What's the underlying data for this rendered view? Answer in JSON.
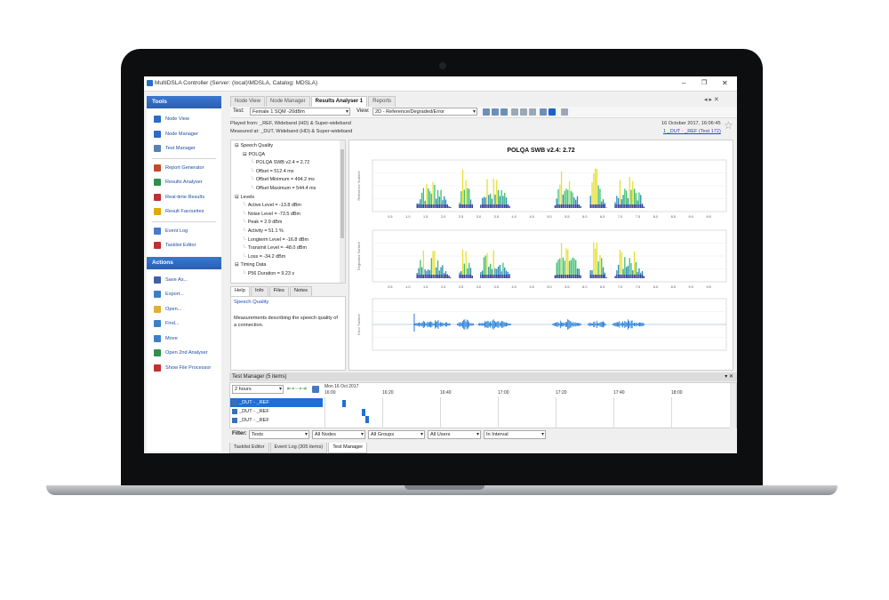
{
  "window": {
    "title": "MultiDSLA Controller (Server: (local)\\MDSLA, Catalog: MDSLA)"
  },
  "tools": {
    "title": "Tools",
    "items": [
      {
        "label": "Node View",
        "icon": "node-view-icon",
        "color": "#2e6bc6"
      },
      {
        "label": "Node Manager",
        "icon": "node-manager-icon",
        "color": "#2e6bc6"
      },
      {
        "label": "Test Manager",
        "icon": "test-manager-icon",
        "color": "#5a7fb8"
      },
      {
        "label": "Report Generator",
        "icon": "report-generator-icon",
        "color": "#c04a2a"
      },
      {
        "label": "Results Analyser",
        "icon": "results-analyser-icon",
        "color": "#2e8f4e"
      },
      {
        "label": "Real-time Results",
        "icon": "real-time-results-icon",
        "color": "#c03030"
      },
      {
        "label": "Result Favourites",
        "icon": "star-icon",
        "color": "#e0a800"
      },
      {
        "label": "Event Log",
        "icon": "event-log-icon",
        "color": "#4a7ac8"
      },
      {
        "label": "Tasklist Editor",
        "icon": "tasklist-editor-icon",
        "color": "#c03030"
      }
    ]
  },
  "actions": {
    "title": "Actions",
    "items": [
      {
        "label": "Save As...",
        "icon": "save-icon",
        "color": "#3d5fa6"
      },
      {
        "label": "Export...",
        "icon": "export-icon",
        "color": "#3d7fc6"
      },
      {
        "label": "Open...",
        "icon": "open-folder-icon",
        "color": "#e0b030"
      },
      {
        "label": "Find...",
        "icon": "find-icon",
        "color": "#3d7fc6"
      },
      {
        "label": "Move",
        "icon": "move-icon",
        "color": "#3d7fc6"
      },
      {
        "label": "Open 2nd Analyser",
        "icon": "analyser-icon",
        "color": "#2e8f4e"
      },
      {
        "label": "Show File Processor",
        "icon": "file-processor-icon",
        "color": "#c03030"
      }
    ]
  },
  "tabs": [
    "Node View",
    "Node Manager",
    "Results Analyser 1",
    "Reports"
  ],
  "toolbar": {
    "test_label": "Test:",
    "test_value": "Female 1 SQM -20dBm",
    "view_label": "View:",
    "view_value": "2D - Reference/Degraded/Error"
  },
  "info": {
    "played_from": "Played from: _REF, Wideband (HD) & Super-wideband",
    "measured_at": "Measured at: _DUT, Wideband (HD) & Super-wideband",
    "date": "16 October 2017, 16:06:45",
    "link": "1 _DUT - _REF (Test 172)"
  },
  "tree": [
    {
      "label": "Speech Quality",
      "level": 0,
      "toggle": "⊟"
    },
    {
      "label": "POLQA",
      "level": 1,
      "toggle": "⊟"
    },
    {
      "label": "POLQA SWB v2.4 = 2.72",
      "level": 2,
      "toggle": ""
    },
    {
      "label": "Offset = 512.4 ms",
      "level": 2,
      "toggle": ""
    },
    {
      "label": "Offset Minimum = 494.2 ms",
      "level": 2,
      "toggle": ""
    },
    {
      "label": "Offset Maximum = 544.4 ms",
      "level": 2,
      "toggle": ""
    },
    {
      "label": "Levels",
      "level": 0,
      "toggle": "⊟"
    },
    {
      "label": "Active Level = -13.8 dBm",
      "level": 1,
      "toggle": ""
    },
    {
      "label": "Noise Level = -73.5 dBm",
      "level": 1,
      "toggle": ""
    },
    {
      "label": "Peak = 2.9 dBm",
      "level": 1,
      "toggle": ""
    },
    {
      "label": "Activity = 51.1 %",
      "level": 1,
      "toggle": ""
    },
    {
      "label": "Longterm Level = -16.8 dBm",
      "level": 1,
      "toggle": ""
    },
    {
      "label": "Transmit Level = -48.0 dBm",
      "level": 1,
      "toggle": ""
    },
    {
      "label": "Loss = -34.2 dBm",
      "level": 1,
      "toggle": ""
    },
    {
      "label": "Timing Data",
      "level": 0,
      "toggle": "⊟"
    },
    {
      "label": "P56 Duration = 9.23 s",
      "level": 1,
      "toggle": ""
    }
  ],
  "help": {
    "tabs": [
      "Help",
      "Info",
      "Files",
      "Notes"
    ],
    "heading": "Speech Quality",
    "text": "Measurements describing the speech quality of a connection."
  },
  "chart": {
    "title": "POLQA SWB v2.4: 2.72",
    "panels": [
      "Reference Surface",
      "Degraded Surface",
      "Error Surface"
    ],
    "x_ticks": [
      "0.5",
      "1.0",
      "1.5",
      "2.0",
      "2.5",
      "3.0",
      "3.5",
      "4.0",
      "4.5",
      "5.0",
      "5.5",
      "6.0",
      "6.5",
      "7.0",
      "7.5",
      "8.0",
      "8.5",
      "9.0",
      "9.5"
    ]
  },
  "test_manager": {
    "title": "Test Manager (5 items)",
    "range": "2 hours",
    "date": "Mon 16 Oct 2017",
    "times": [
      "16:00",
      "16:20",
      "16:40",
      "17:00",
      "17:20",
      "17:40",
      "18:00"
    ],
    "rows": [
      "_DUT - _REF",
      "_DUT - _REF",
      "_DUT - _REF"
    ]
  },
  "filter": {
    "label": "Filter:",
    "values": [
      "Tests",
      "All Nodes",
      "All Groups",
      "All Users",
      "In Interval"
    ]
  },
  "bottom_tabs": [
    "Tasklist Editor",
    "Event Log (305 items)",
    "Test Manager"
  ]
}
